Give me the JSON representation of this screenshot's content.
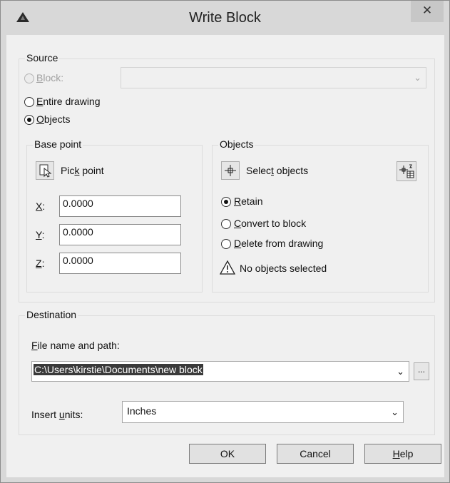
{
  "window": {
    "title": "Write Block",
    "close_glyph": "✕"
  },
  "source": {
    "legend": "Source",
    "block_label": {
      "pre": "",
      "key": "B",
      "post": "lock:"
    },
    "block_value": "",
    "block_enabled": false,
    "entire_drawing_label": {
      "pre": "",
      "key": "E",
      "post": "ntire drawing"
    },
    "objects_label": {
      "pre": "",
      "key": "O",
      "post": "bjects"
    },
    "selected": "objects"
  },
  "base_point": {
    "legend": "Base point",
    "pick_point_label": {
      "pre": "Pic",
      "key": "k",
      "post": " point"
    },
    "x_label": {
      "key": "X",
      "post": ":"
    },
    "y_label": {
      "key": "Y",
      "post": ":"
    },
    "z_label": {
      "key": "Z",
      "post": ":"
    },
    "x_value": "0.0000",
    "y_value": "0.0000",
    "z_value": "0.0000"
  },
  "objects": {
    "legend": "Objects",
    "select_objects_label": {
      "pre": "Selec",
      "key": "t",
      "post": " objects"
    },
    "retain_label": {
      "pre": "",
      "key": "R",
      "post": "etain"
    },
    "convert_label": {
      "pre": "",
      "key": "C",
      "post": "onvert to block"
    },
    "delete_label": {
      "pre": "",
      "key": "D",
      "post": "elete from drawing"
    },
    "selected": "retain",
    "status": "No objects selected"
  },
  "destination": {
    "legend": "Destination",
    "file_label": {
      "pre": "",
      "key": "F",
      "post": "ile name and path:"
    },
    "file_value": "C:\\Users\\kirstie\\Documents\\new block",
    "browse_label": "...",
    "units_label": {
      "pre": "Insert ",
      "key": "u",
      "post": "nits:"
    },
    "units_value": "Inches"
  },
  "buttons": {
    "ok": "OK",
    "cancel": "Cancel",
    "help": {
      "pre": "",
      "key": "H",
      "post": "elp"
    }
  },
  "icons": {
    "app": "autocad-logo-icon",
    "pick_point": "pick-point-icon",
    "select_objects": "select-objects-crosshair-icon",
    "quick_select": "quick-select-icon",
    "warning": "warning-triangle-icon",
    "chevron": "chevron-down-icon"
  }
}
